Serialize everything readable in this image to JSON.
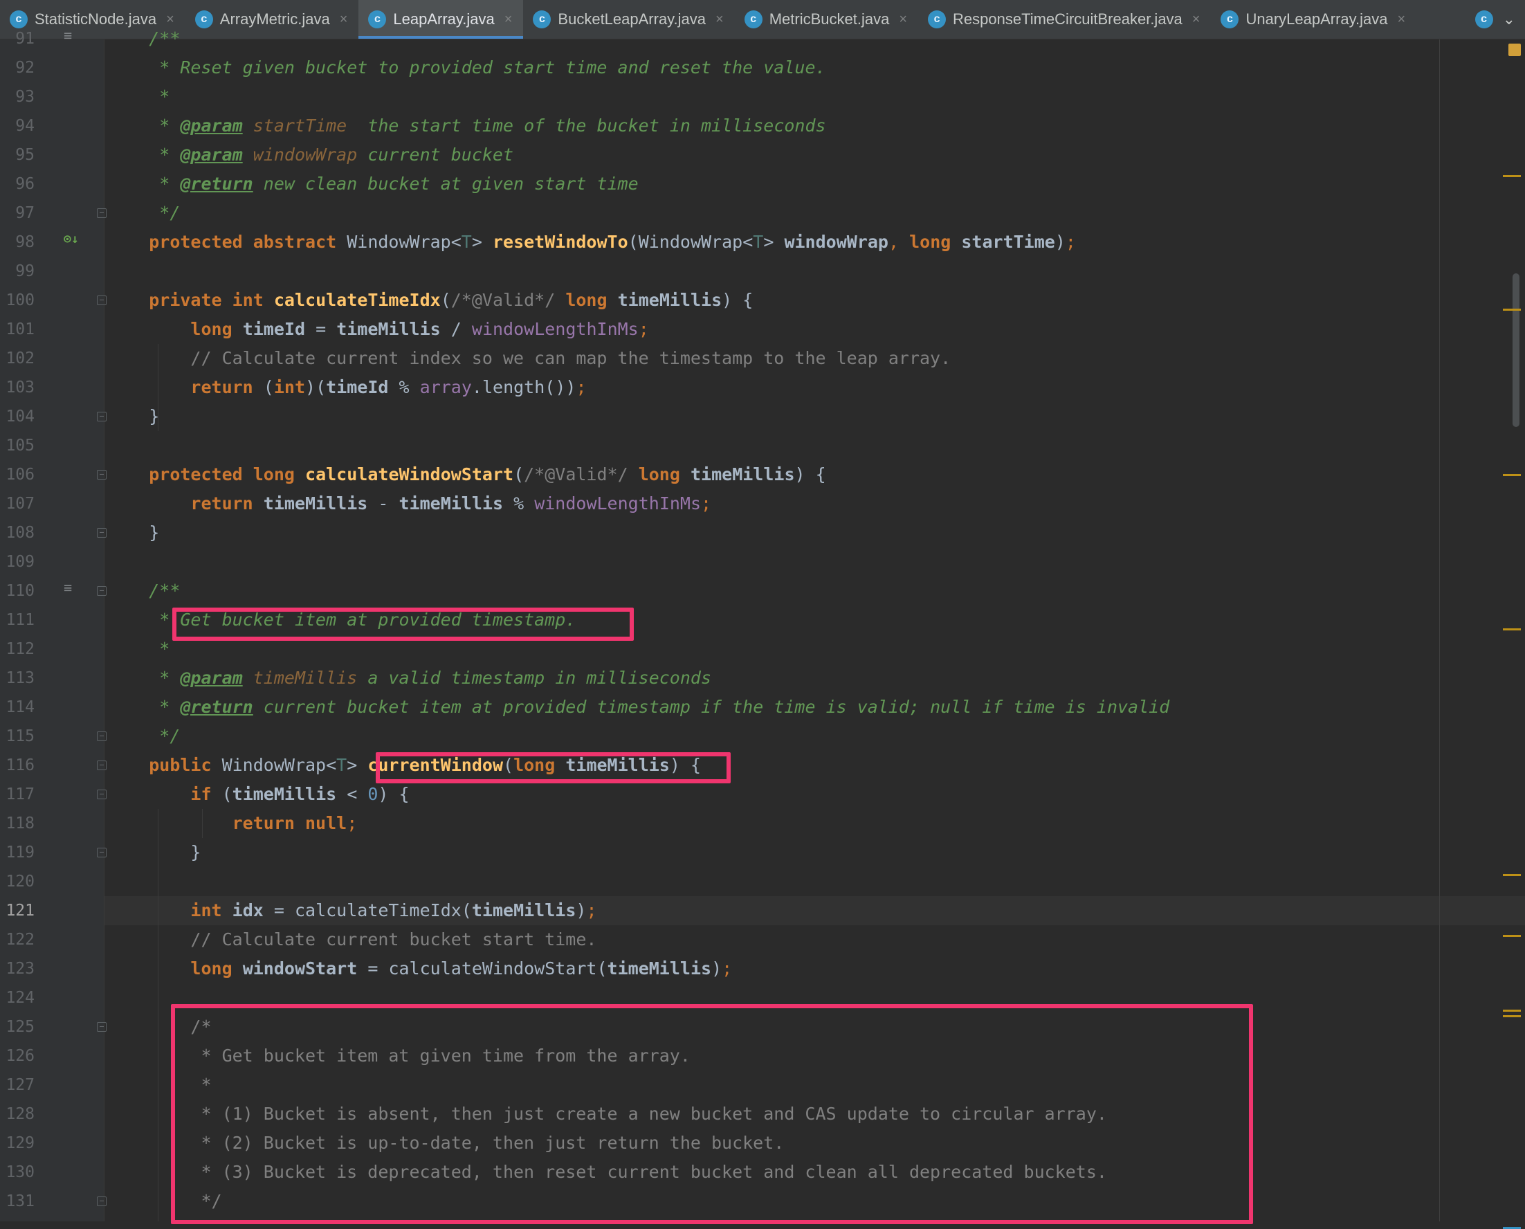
{
  "tabs": [
    {
      "label": "StatisticNode.java",
      "icon": "class-icon",
      "active": false
    },
    {
      "label": "ArrayMetric.java",
      "icon": "class-icon",
      "active": false
    },
    {
      "label": "LeapArray.java",
      "icon": "abstract-class-icon",
      "active": true
    },
    {
      "label": "BucketLeapArray.java",
      "icon": "class-icon",
      "active": false
    },
    {
      "label": "MetricBucket.java",
      "icon": "class-icon",
      "active": false
    },
    {
      "label": "ResponseTimeCircuitBreaker.java",
      "icon": "class-icon",
      "active": false
    },
    {
      "label": "UnaryLeapArray.java",
      "icon": "class-icon",
      "active": false
    }
  ],
  "tab_overflow_icon": "class-icon",
  "current_line": 121,
  "lines": [
    {
      "n": 91,
      "code": "    /**"
    },
    {
      "n": 92,
      "code": "     * Reset given bucket to provided start time and reset the value."
    },
    {
      "n": 93,
      "code": "     *"
    },
    {
      "n": 94,
      "code": "     * @param startTime  the start time of the bucket in milliseconds"
    },
    {
      "n": 95,
      "code": "     * @param windowWrap current bucket"
    },
    {
      "n": 96,
      "code": "     * @return new clean bucket at given start time"
    },
    {
      "n": 97,
      "code": "     */"
    },
    {
      "n": 98,
      "code": "    protected abstract WindowWrap<T> resetWindowTo(WindowWrap<T> windowWrap, long startTime);"
    },
    {
      "n": 99,
      "code": ""
    },
    {
      "n": 100,
      "code": "    private int calculateTimeIdx(/*@Valid*/ long timeMillis) {"
    },
    {
      "n": 101,
      "code": "        long timeId = timeMillis / windowLengthInMs;"
    },
    {
      "n": 102,
      "code": "        // Calculate current index so we can map the timestamp to the leap array."
    },
    {
      "n": 103,
      "code": "        return (int)(timeId % array.length());"
    },
    {
      "n": 104,
      "code": "    }"
    },
    {
      "n": 105,
      "code": ""
    },
    {
      "n": 106,
      "code": "    protected long calculateWindowStart(/*@Valid*/ long timeMillis) {"
    },
    {
      "n": 107,
      "code": "        return timeMillis - timeMillis % windowLengthInMs;"
    },
    {
      "n": 108,
      "code": "    }"
    },
    {
      "n": 109,
      "code": ""
    },
    {
      "n": 110,
      "code": "    /**"
    },
    {
      "n": 111,
      "code": "     * Get bucket item at provided timestamp."
    },
    {
      "n": 112,
      "code": "     *"
    },
    {
      "n": 113,
      "code": "     * @param timeMillis a valid timestamp in milliseconds"
    },
    {
      "n": 114,
      "code": "     * @return current bucket item at provided timestamp if the time is valid; null if time is invalid"
    },
    {
      "n": 115,
      "code": "     */"
    },
    {
      "n": 116,
      "code": "    public WindowWrap<T> currentWindow(long timeMillis) {"
    },
    {
      "n": 117,
      "code": "        if (timeMillis < 0) {"
    },
    {
      "n": 118,
      "code": "            return null;"
    },
    {
      "n": 119,
      "code": "        }"
    },
    {
      "n": 120,
      "code": ""
    },
    {
      "n": 121,
      "code": "        int idx = calculateTimeIdx(timeMillis);"
    },
    {
      "n": 122,
      "code": "        // Calculate current bucket start time."
    },
    {
      "n": 123,
      "code": "        long windowStart = calculateWindowStart(timeMillis);"
    },
    {
      "n": 124,
      "code": ""
    },
    {
      "n": 125,
      "code": "        /*"
    },
    {
      "n": 126,
      "code": "         * Get bucket item at given time from the array."
    },
    {
      "n": 127,
      "code": "         *"
    },
    {
      "n": 128,
      "code": "         * (1) Bucket is absent, then just create a new bucket and CAS update to circular array."
    },
    {
      "n": 129,
      "code": "         * (2) Bucket is up-to-date, then just return the bucket."
    },
    {
      "n": 130,
      "code": "         * (3) Bucket is deprecated, then reset current bucket and clean all deprecated buckets."
    },
    {
      "n": 131,
      "code": "         */"
    }
  ],
  "highlights": [
    {
      "label": "doc-summary-highlight",
      "text": "Get bucket item at provided timestamp."
    },
    {
      "label": "method-signature-highlight",
      "text": "currentWindow(long timeMillis)"
    },
    {
      "label": "algorithm-comment-highlight",
      "text": "Get bucket item at given time from the array."
    }
  ],
  "colors": {
    "background": "#2b2b2b",
    "gutter": "#313335",
    "keyword": "#cc7832",
    "method": "#ffc66d",
    "field": "#9876aa",
    "number": "#6897bb",
    "comment": "#808080",
    "doc_comment": "#629755",
    "type_param": "#507874",
    "highlight_box": "#f0356e",
    "active_tab_underline": "#4a88c7"
  }
}
